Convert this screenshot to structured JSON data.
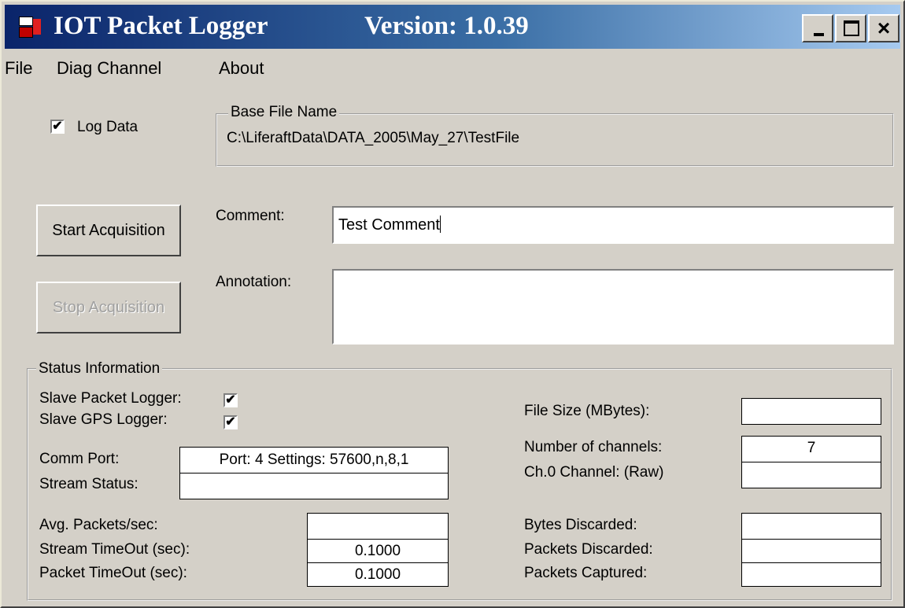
{
  "window": {
    "app_name": "IOT Packet Logger",
    "version": "Version: 1.0.39",
    "minimize_label": "_",
    "close_label": "×"
  },
  "menu": [
    "File",
    "Diag Channel",
    "About"
  ],
  "log_data": {
    "label": "Log Data",
    "checked": true,
    "check": "✔"
  },
  "base_file": {
    "title": "Base File Name",
    "value": "C:\\LiferaftData\\DATA_2005\\May_27\\TestFile"
  },
  "buttons": {
    "start": "Start Acquisition",
    "stop": "Stop Acquisition"
  },
  "comment": {
    "label": "Comment:",
    "value": "Test Comment"
  },
  "annotation": {
    "label": "Annotation:",
    "value": ""
  },
  "status": {
    "title": "Status Information",
    "slave_packet_logger": "Slave Packet Logger:",
    "slave_gps_logger": "Slave GPS Logger:",
    "check": "✔",
    "comm_port_label": "Comm Port:",
    "comm_port_value": "Port:  4   Settings: 57600,n,8,1",
    "stream_status_label": "Stream Status:",
    "stream_status_value": "",
    "avg_packets_label": "Avg. Packets/sec:",
    "avg_packets_value": "",
    "stream_timeout_label": "Stream TimeOut (sec):",
    "stream_timeout_value": "0.1000",
    "packet_timeout_label": "Packet TimeOut (sec):",
    "packet_timeout_value": "0.1000",
    "file_size_label": "File Size (MBytes):",
    "file_size_value": "",
    "num_channels_label": "Number of channels:",
    "num_channels_value": "7",
    "ch0_label": "Ch.0 Channel: (Raw)",
    "ch0_value": "",
    "bytes_discarded_label": "Bytes Discarded:",
    "bytes_discarded_value": "",
    "packets_discarded_label": "Packets Discarded:",
    "packets_discarded_value": "",
    "packets_captured_label": "Packets Captured:",
    "packets_captured_value": ""
  }
}
